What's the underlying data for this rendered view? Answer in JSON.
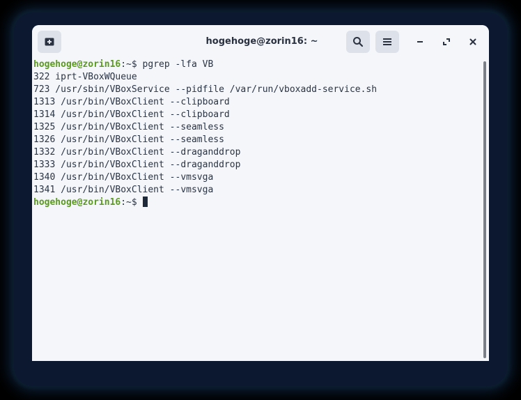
{
  "window": {
    "title": "hogehoge@zorin16: ~"
  },
  "icons": {
    "new_tab": "new-tab-icon",
    "search": "search-icon",
    "menu": "hamburger-menu-icon",
    "minimize": "minimize-icon",
    "maximize": "maximize-icon",
    "close": "close-icon"
  },
  "colors": {
    "prompt_user": "#5a9a1e",
    "text": "#2a3444",
    "background": "#f4f6fa"
  },
  "terminal": {
    "prompt_user": "hogehoge@zorin16",
    "prompt_path": ":~$ ",
    "command": "pgrep -lfa VB",
    "output": [
      "322 iprt-VBoxWQueue",
      "723 /usr/sbin/VBoxService --pidfile /var/run/vboxadd-service.sh",
      "1313 /usr/bin/VBoxClient --clipboard",
      "1314 /usr/bin/VBoxClient --clipboard",
      "1325 /usr/bin/VBoxClient --seamless",
      "1326 /usr/bin/VBoxClient --seamless",
      "1332 /usr/bin/VBoxClient --draganddrop",
      "1333 /usr/bin/VBoxClient --draganddrop",
      "1340 /usr/bin/VBoxClient --vmsvga",
      "1341 /usr/bin/VBoxClient --vmsvga"
    ],
    "second_prompt_user": "hogehoge@zorin16",
    "second_prompt_path": ":~$ "
  }
}
